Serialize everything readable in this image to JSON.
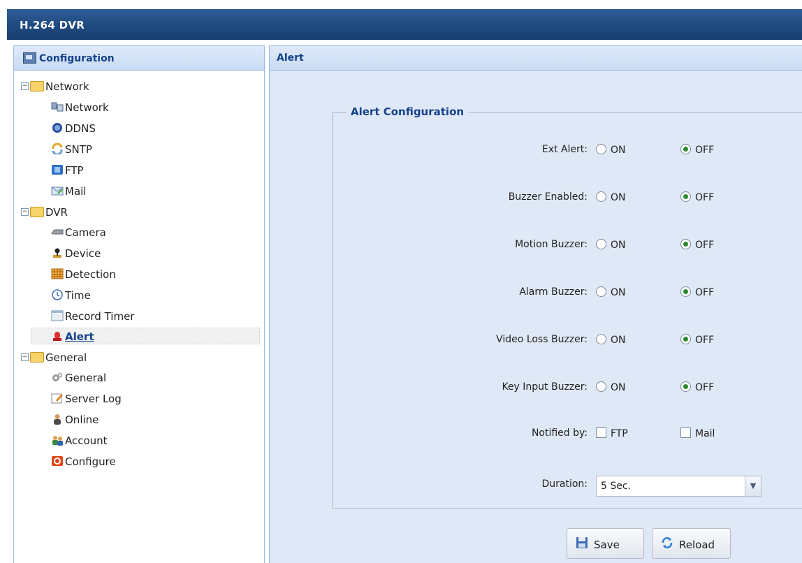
{
  "app": {
    "title": "H.264 DVR"
  },
  "left_panel": {
    "title": "Configuration",
    "tree": [
      {
        "label": "Network",
        "kind": "folder"
      },
      {
        "label": "Network",
        "kind": "item",
        "icon": "network-icon"
      },
      {
        "label": "DDNS",
        "kind": "item",
        "icon": "ddns-icon"
      },
      {
        "label": "SNTP",
        "kind": "item",
        "icon": "sntp-icon"
      },
      {
        "label": "FTP",
        "kind": "item",
        "icon": "ftp-icon"
      },
      {
        "label": "Mail",
        "kind": "item",
        "icon": "mail-icon"
      },
      {
        "label": "DVR",
        "kind": "folder"
      },
      {
        "label": "Camera",
        "kind": "item",
        "icon": "camera-icon"
      },
      {
        "label": "Device",
        "kind": "item",
        "icon": "device-icon"
      },
      {
        "label": "Detection",
        "kind": "item",
        "icon": "detection-icon"
      },
      {
        "label": "Time",
        "kind": "item",
        "icon": "clock-icon"
      },
      {
        "label": "Record Timer",
        "kind": "item",
        "icon": "record-timer-icon"
      },
      {
        "label": "Alert",
        "kind": "item",
        "icon": "alert-icon",
        "selected": true
      },
      {
        "label": "General",
        "kind": "folder"
      },
      {
        "label": "General",
        "kind": "item",
        "icon": "general-icon"
      },
      {
        "label": "Server Log",
        "kind": "item",
        "icon": "server-log-icon"
      },
      {
        "label": "Online",
        "kind": "item",
        "icon": "online-icon"
      },
      {
        "label": "Account",
        "kind": "item",
        "icon": "account-icon"
      },
      {
        "label": "Configure",
        "kind": "item",
        "icon": "configure-icon"
      }
    ]
  },
  "main": {
    "title": "Alert",
    "fieldset_title": "Alert Configuration",
    "options": [
      {
        "label": "Ext Alert:",
        "on": "ON",
        "off": "OFF",
        "value": "OFF"
      },
      {
        "label": "Buzzer Enabled:",
        "on": "ON",
        "off": "OFF",
        "value": "OFF"
      },
      {
        "label": "Motion Buzzer:",
        "on": "ON",
        "off": "OFF",
        "value": "OFF"
      },
      {
        "label": "Alarm Buzzer:",
        "on": "ON",
        "off": "OFF",
        "value": "OFF"
      },
      {
        "label": "Video Loss Buzzer:",
        "on": "ON",
        "off": "OFF",
        "value": "OFF"
      },
      {
        "label": "Key Input Buzzer:",
        "on": "ON",
        "off": "OFF",
        "value": "OFF"
      }
    ],
    "notified_by": {
      "label": "Notified by:",
      "ftp": "FTP",
      "mail": "Mail",
      "ftp_checked": false,
      "mail_checked": false
    },
    "duration": {
      "label": "Duration:",
      "value": "5 Sec."
    },
    "buttons": {
      "save": "Save",
      "reload": "Reload"
    }
  },
  "colors": {
    "title_bar": "#1f4a80",
    "panel_header_text": "#15428b",
    "radio_selected": "#2c8a2c"
  }
}
